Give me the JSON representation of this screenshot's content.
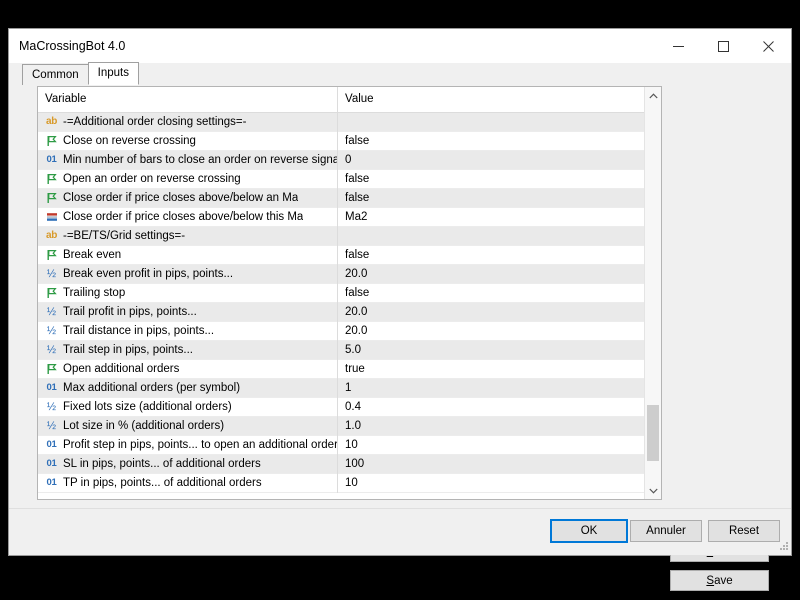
{
  "window": {
    "title": "MaCrossingBot 4.0",
    "controls": {
      "minimize": "minimize-icon",
      "maximize": "maximize-icon",
      "close": "close-icon"
    }
  },
  "tabs": [
    {
      "label": "Common",
      "active": false
    },
    {
      "label": "Inputs",
      "active": true
    }
  ],
  "grid": {
    "columns": [
      "Variable",
      "Value"
    ],
    "rows": [
      {
        "icon": "string",
        "variable": "-=Additional order closing settings=-",
        "value": ""
      },
      {
        "icon": "bool",
        "variable": "Close on reverse crossing",
        "value": "false"
      },
      {
        "icon": "int",
        "variable": "Min number of bars to close an order on reverse signal",
        "value": "0"
      },
      {
        "icon": "bool",
        "variable": "Open an order on reverse crossing",
        "value": "false"
      },
      {
        "icon": "bool",
        "variable": "Close order if price closes above/below an Ma",
        "value": "false"
      },
      {
        "icon": "enum",
        "variable": "Close order if price closes above/below this Ma",
        "value": "Ma2"
      },
      {
        "icon": "string",
        "variable": "-=BE/TS/Grid settings=-",
        "value": ""
      },
      {
        "icon": "bool",
        "variable": "Break even",
        "value": "false"
      },
      {
        "icon": "double",
        "variable": "Break even profit in pips, points...",
        "value": "20.0"
      },
      {
        "icon": "bool",
        "variable": "Trailing stop",
        "value": "false"
      },
      {
        "icon": "double",
        "variable": "Trail profit in pips, points...",
        "value": "20.0"
      },
      {
        "icon": "double",
        "variable": "Trail distance in pips, points...",
        "value": "20.0"
      },
      {
        "icon": "double",
        "variable": "Trail step in pips, points...",
        "value": "5.0"
      },
      {
        "icon": "bool",
        "variable": "Open additional orders",
        "value": "true"
      },
      {
        "icon": "int",
        "variable": "Max additional orders (per symbol)",
        "value": "1"
      },
      {
        "icon": "double",
        "variable": "Fixed lots size (additional orders)",
        "value": "0.4"
      },
      {
        "icon": "double",
        "variable": "Lot size in % (additional orders)",
        "value": "1.0"
      },
      {
        "icon": "int",
        "variable": "Profit step in pips, points... to open an additional order",
        "value": "10"
      },
      {
        "icon": "int",
        "variable": "SL in pips, points... of additional orders",
        "value": "100"
      },
      {
        "icon": "int",
        "variable": "TP in pips, points... of additional orders",
        "value": "10"
      }
    ]
  },
  "side_buttons": {
    "load": {
      "accel": "L",
      "rest": "oad"
    },
    "save": {
      "accel": "S",
      "rest": "ave"
    }
  },
  "footer_buttons": {
    "ok": "OK",
    "cancel": "Annuler",
    "reset": "Reset"
  },
  "colors": {
    "accent": "#0078d7",
    "type_string": "#d89a2a",
    "type_int": "#2f6fb8",
    "type_bool": "#2e9b45",
    "row_alt": "#eaeaea"
  }
}
